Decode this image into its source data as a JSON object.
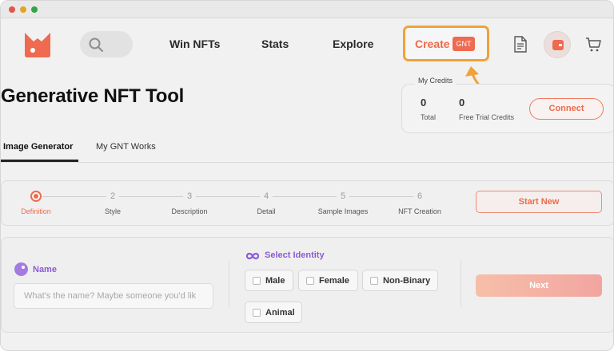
{
  "header": {
    "nav": [
      "Win NFTs",
      "Stats",
      "Explore"
    ],
    "create_label": "Create",
    "create_badge": "GNT",
    "brand_color": "#EF6A4F",
    "highlight_color": "#F0A23A",
    "icons": [
      "search-icon",
      "document-icon",
      "wallet-icon",
      "cart-icon"
    ]
  },
  "page": {
    "title": "Generative NFT Tool"
  },
  "credits": {
    "title": "My Credits",
    "total_value": "0",
    "total_label": "Total",
    "trial_value": "0",
    "trial_label": "Free Trial Credits",
    "connect_label": "Connect"
  },
  "tabs": [
    {
      "label": "Image Generator",
      "active": true
    },
    {
      "label": "My GNT Works",
      "active": false
    }
  ],
  "stepper": {
    "steps": [
      {
        "num": "1",
        "label": "Definition",
        "active": true
      },
      {
        "num": "2",
        "label": "Style",
        "active": false
      },
      {
        "num": "3",
        "label": "Description",
        "active": false
      },
      {
        "num": "4",
        "label": "Detail",
        "active": false
      },
      {
        "num": "5",
        "label": "Sample Images",
        "active": false
      },
      {
        "num": "6",
        "label": "NFT Creation",
        "active": false
      }
    ],
    "start_new_label": "Start New"
  },
  "form": {
    "name_label": "Name",
    "name_placeholder": "What's the name? Maybe someone you'd lik",
    "identity_label": "Select Identity",
    "identity_options": [
      "Male",
      "Female",
      "Non-Binary",
      "Animal"
    ],
    "next_label": "Next",
    "accent_color": "#8B5BD6"
  }
}
